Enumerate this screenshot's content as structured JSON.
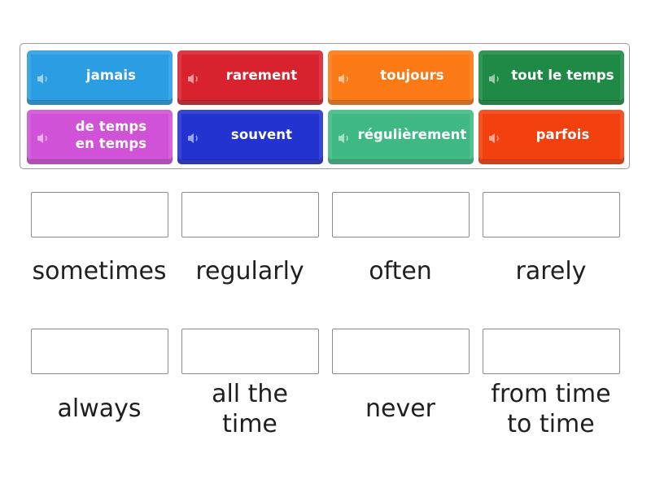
{
  "tiles": [
    {
      "label": "jamais",
      "color": "#2a9de3"
    },
    {
      "label": "rarement",
      "color": "#d8232f"
    },
    {
      "label": "toujours",
      "color": "#fb7a15"
    },
    {
      "label": "tout le temps",
      "color": "#1f8a45"
    },
    {
      "label": "de temps en temps",
      "color": "#d052d6"
    },
    {
      "label": "souvent",
      "color": "#2233cf"
    },
    {
      "label": "régulièrement",
      "color": "#3fb983"
    },
    {
      "label": "parfois",
      "color": "#f2410f"
    }
  ],
  "targets": [
    {
      "label": "sometimes"
    },
    {
      "label": "regularly"
    },
    {
      "label": "often"
    },
    {
      "label": "rarely"
    },
    {
      "label": "always"
    },
    {
      "label": "all the time"
    },
    {
      "label": "never"
    },
    {
      "label": "from time to time"
    }
  ],
  "icons": {
    "tile_audio": "speaker-icon"
  }
}
